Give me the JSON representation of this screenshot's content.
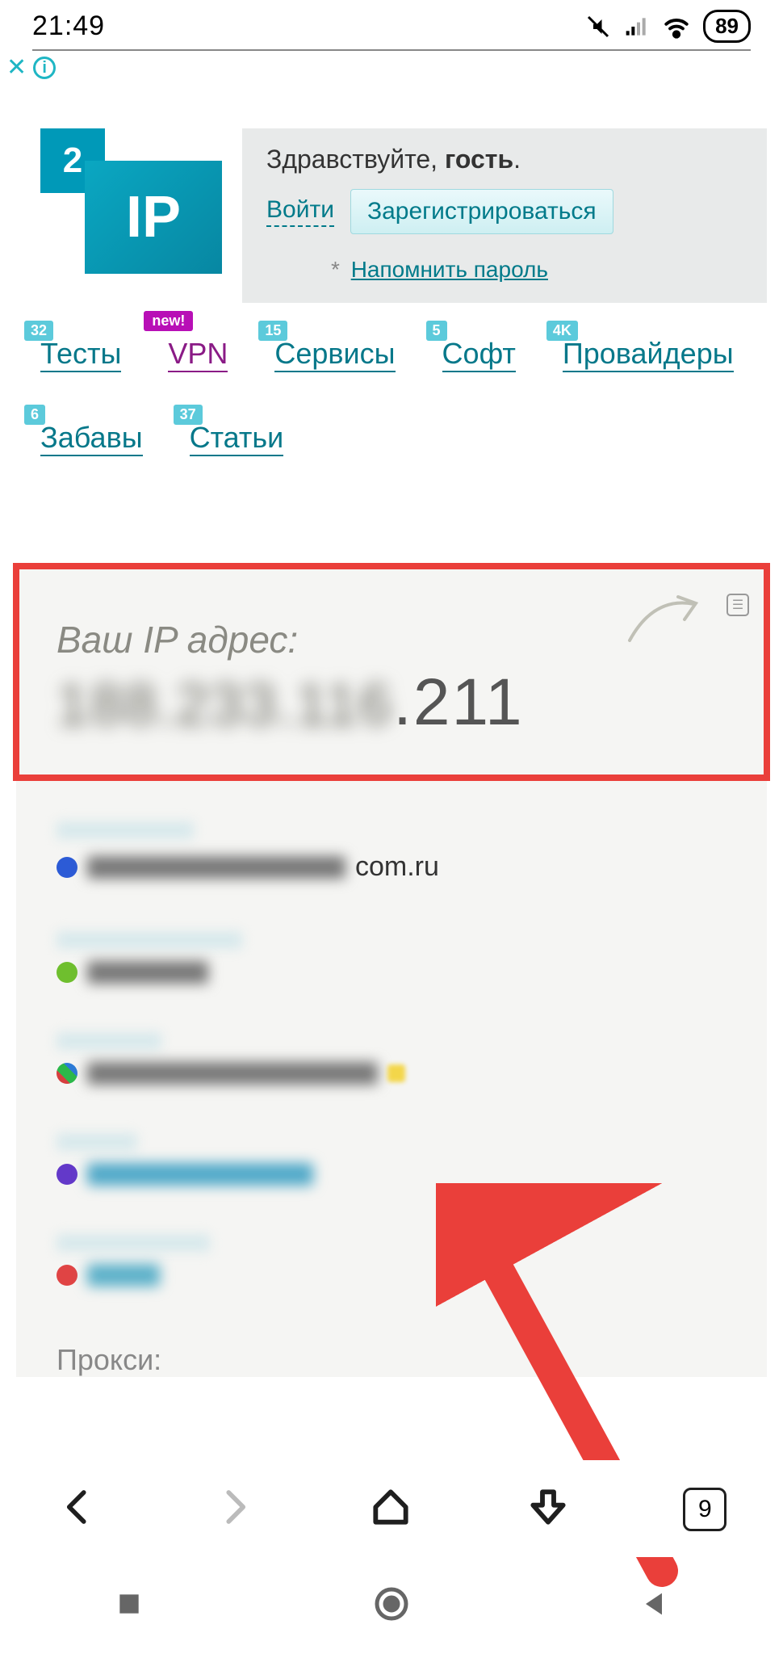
{
  "status": {
    "time": "21:49",
    "battery": "89"
  },
  "greeting": {
    "hello": "Здравствуйте, ",
    "guest": "гость",
    "period": ".",
    "login": "Войти",
    "register": "Зарегистрироваться",
    "asterisk": "*",
    "remind": "Напомнить пароль"
  },
  "logo": {
    "top": "2",
    "main": "IP"
  },
  "nav": [
    {
      "badge": "32",
      "label": "Тесты"
    },
    {
      "new": "new!",
      "label": "VPN",
      "vpn": true
    },
    {
      "badge": "15",
      "label": "Сервисы"
    },
    {
      "badge": "5",
      "label": "Софт"
    },
    {
      "badge": "4K",
      "label": "Провайдеры"
    },
    {
      "badge": "6",
      "label": "Забавы"
    },
    {
      "badge": "37",
      "label": "Статьи"
    }
  ],
  "ip": {
    "label": "Ваш IP адрес:",
    "blurred": "188.233.116",
    "visible": ".211"
  },
  "details": {
    "domain_suffix": "com.ru",
    "proxy_label": "Прокси:"
  },
  "browser": {
    "tabs": "9"
  },
  "adinfo": {
    "i": "i"
  }
}
